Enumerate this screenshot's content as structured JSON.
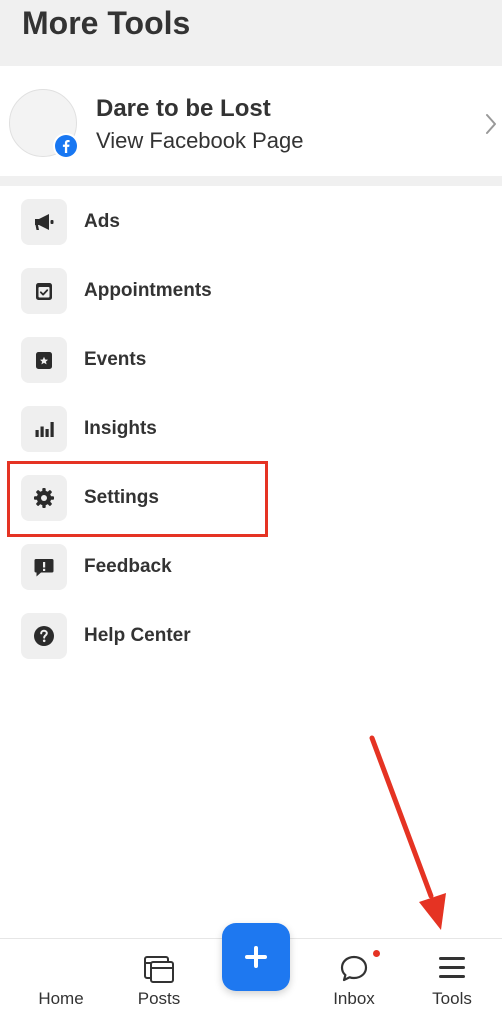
{
  "header": {
    "title": "More Tools"
  },
  "page": {
    "name": "Dare to be Lost",
    "subtitle": "View Facebook Page"
  },
  "menu": {
    "items": [
      {
        "label": "Ads",
        "icon": "megaphone-icon"
      },
      {
        "label": "Appointments",
        "icon": "calendar-check-icon"
      },
      {
        "label": "Events",
        "icon": "calendar-star-icon"
      },
      {
        "label": "Insights",
        "icon": "bar-chart-icon"
      },
      {
        "label": "Settings",
        "icon": "gear-icon"
      },
      {
        "label": "Feedback",
        "icon": "feedback-icon"
      },
      {
        "label": "Help Center",
        "icon": "question-icon"
      }
    ]
  },
  "bottom_nav": {
    "items": [
      {
        "label": "Home"
      },
      {
        "label": "Posts"
      },
      {
        "label": "Inbox"
      },
      {
        "label": "Tools"
      }
    ],
    "create_icon": "plus-icon"
  },
  "colors": {
    "accent": "#1e78f0",
    "annotation": "#e53323",
    "header_bg": "#f0f0f0",
    "text": "#333333"
  }
}
